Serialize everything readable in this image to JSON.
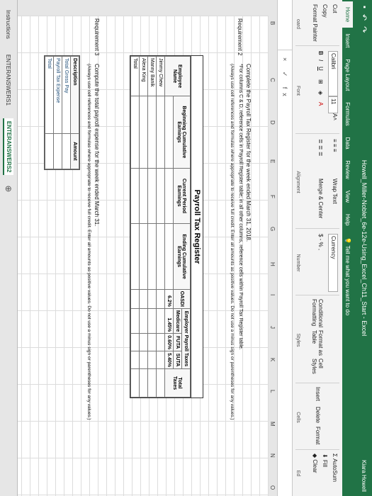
{
  "window": {
    "title": "Howell_Miller-Noblet_6e-12e-Using_Excel_Ch11_Start - Excel",
    "user": "Kiara Howell"
  },
  "tabs": [
    "Home",
    "Insert",
    "Page Layout",
    "Formulas",
    "Data",
    "Review",
    "View",
    "Help"
  ],
  "tell_me": "Tell me what you want to do",
  "ribbon": {
    "clipboard": {
      "cut": "Cut",
      "copy": "Copy",
      "format_painter": "Format Painter",
      "label": "oard"
    },
    "font": {
      "name": "Calibri",
      "size": "11",
      "label": "Font"
    },
    "alignment": {
      "wrap": "Wrap Text",
      "merge": "Merge & Center",
      "label": "Alignment"
    },
    "number": {
      "format": "Currency",
      "symbols": "$ - % ,",
      "label": "Number"
    },
    "styles": {
      "conditional": "Conditional Formatting",
      "format_as_table": "Format as Table",
      "cell_styles": "Cell Styles",
      "label": "Styles"
    },
    "cells": {
      "insert": "Insert",
      "delete": "Delete",
      "format": "Format",
      "label": "Cells"
    },
    "editing": {
      "autosum": "AutoSum",
      "fill": "Fill",
      "clear": "Clear",
      "label": "Ed"
    }
  },
  "formula_bar": {
    "fx": "× ✓ fx"
  },
  "columns": [
    "B",
    "C",
    "D",
    "E",
    "F",
    "G",
    "H",
    "I",
    "J",
    "K",
    "L",
    "M",
    "N",
    "O"
  ],
  "requirement2": {
    "label": "Requirement 2",
    "line1": "Complete the Payroll Tax Register for the week ended March 31, 2018.",
    "line2": "*For columns C & D, reference cells in Payroll Register table; in all other columns, reference cells within Payroll Tax Register table.",
    "line3": "(Always use cell references and formulas where appropriate to receive full credit. Enter all amounts as positive values. Do not use a minus sign or parentheses for any values.)"
  },
  "register": {
    "title": "Payroll Tax Register",
    "headers": {
      "employee_name": "Employee Name",
      "beginning": "Beginning Cumulative Earnings",
      "current": "Current Period Earnings",
      "ending": "Ending Cumulative Earnings",
      "oasdi": "OASDI",
      "medicare": "Medicare",
      "futa": "FUTA",
      "suta": "SUTA",
      "employer_taxes": "Employer Payroll Taxes",
      "total_taxes": "Total Taxes"
    },
    "rates": {
      "oasdi": "6.2%",
      "medicare": "1.45%",
      "futa": "0.60%",
      "suta": "5.40%"
    },
    "employees": [
      "Jimmy Chew",
      "Manny Banik",
      "Alexa King"
    ],
    "total_label": "Total"
  },
  "requirement3": {
    "label": "Requirement 3",
    "line1": "Compute the total payroll expense for the week ended March 31.",
    "line2": "(Always use cell references and formulas where appropriate to receive full credit. Enter all amounts as positive values. Do not use a minus sign or parentheses for any values.)"
  },
  "expense_table": {
    "col_desc": "Description",
    "col_amount": "Amount",
    "rows": [
      "Total Gross Pay",
      "Payroll Tax Expense",
      "Total"
    ]
  },
  "sheet_tabs": [
    "Instructions",
    "ENTERANSWERS1",
    "ENTERANSWERS2"
  ]
}
